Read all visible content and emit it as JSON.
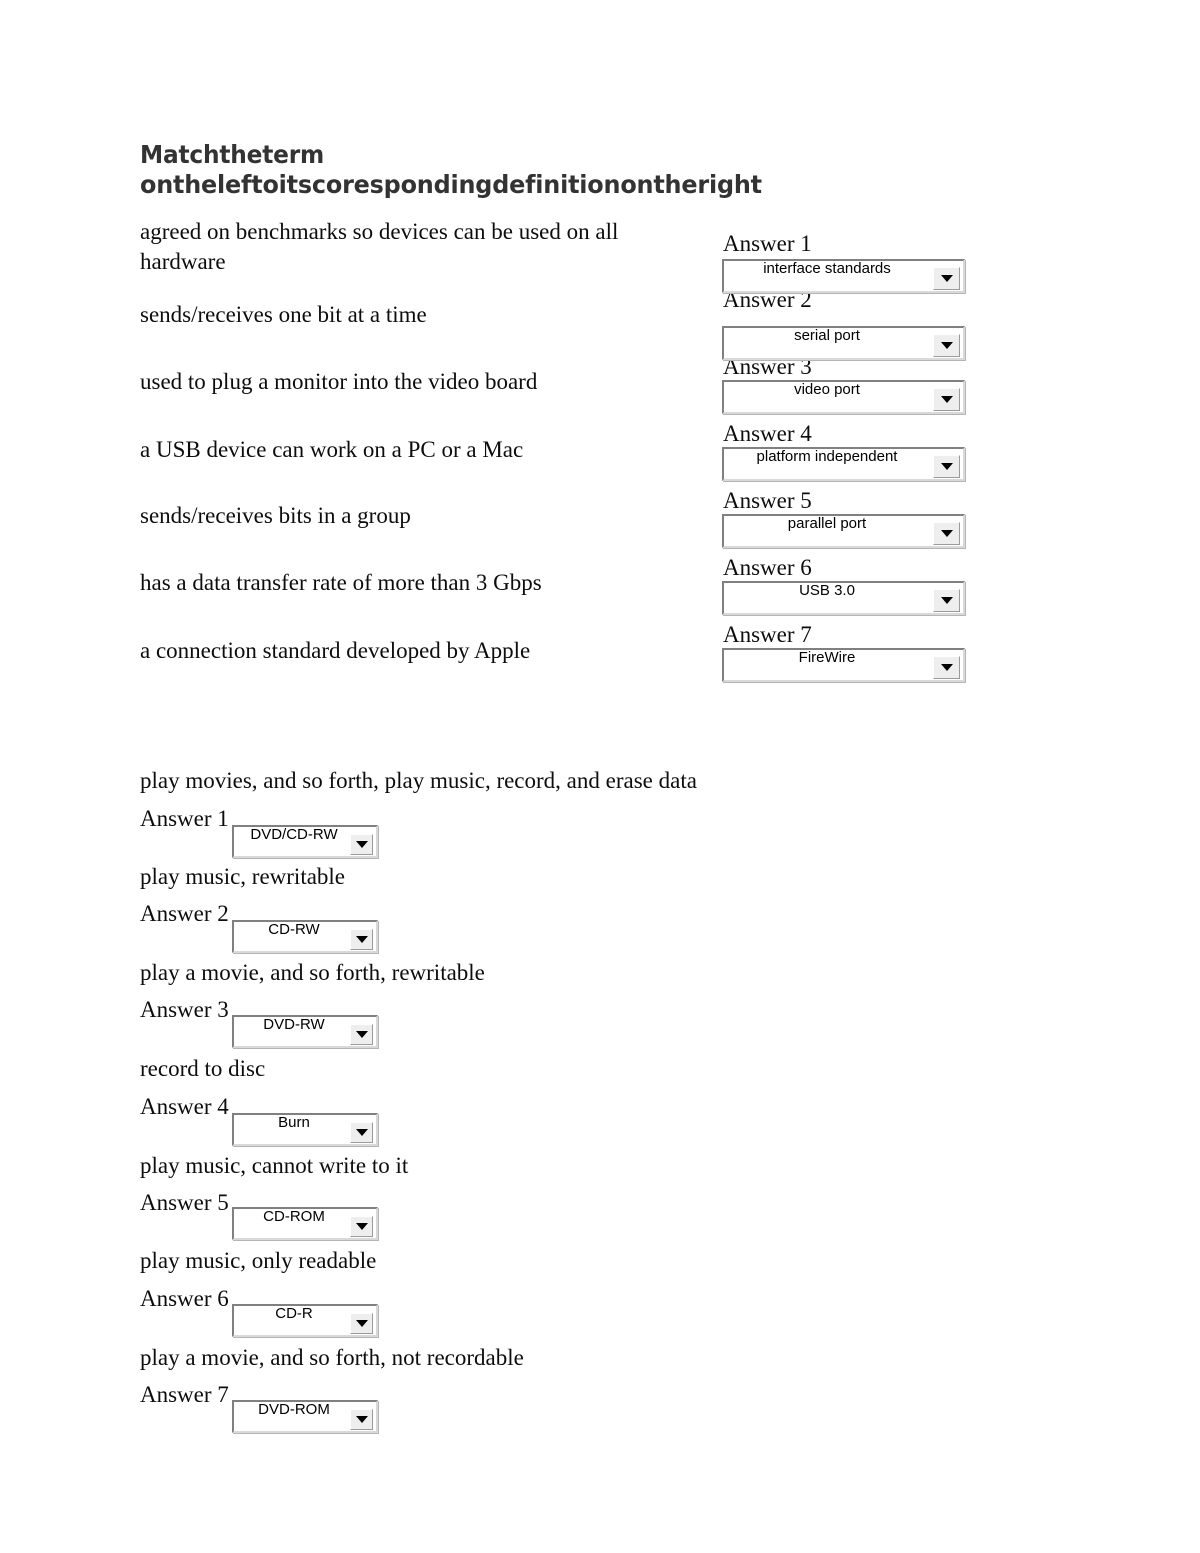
{
  "document": {
    "title_line_1": "Matchtheterm",
    "title_line_2": "ontheleftoitscorespondingdefinitionontheright"
  },
  "section_ports": {
    "terms": [
      "agreed on benchmarks so devices can be used on all hardware",
      "sends/receives one bit at a time",
      "used to plug a monitor into the video board",
      "a USB device can work on a PC or a Mac",
      "sends/receives bits in a group",
      "has a data transfer rate of more than 3 Gbps",
      "a connection standard developed by Apple"
    ],
    "answers": [
      {
        "label": "Answer 1",
        "value": "interface standards"
      },
      {
        "label": "Answer 2",
        "value": "serial port"
      },
      {
        "label": "Answer 3",
        "value": "video port"
      },
      {
        "label": "Answer 4",
        "value": "platform independent"
      },
      {
        "label": "Answer 5",
        "value": "parallel port"
      },
      {
        "label": "Answer 6",
        "value": "USB 3.0"
      },
      {
        "label": "Answer 7",
        "value": "FireWire"
      }
    ]
  },
  "section_discs": {
    "rows": [
      {
        "term": "play movies, and so forth, play music, record, and erase data",
        "label": "Answer 1",
        "value": "DVD/CD-RW"
      },
      {
        "term": "play music, rewritable",
        "label": "Answer 2",
        "value": "CD-RW"
      },
      {
        "term": "play a movie, and so forth, rewritable",
        "label": "Answer 3",
        "value": "DVD-RW"
      },
      {
        "term": "record to disc",
        "label": "Answer 4",
        "value": "Burn"
      },
      {
        "term": "play music, cannot write to it",
        "label": "Answer 5",
        "value": "CD-ROM"
      },
      {
        "term": "play music, only readable",
        "label": "Answer 6",
        "value": "CD-R"
      },
      {
        "term": "play a movie, and so forth, not recordable",
        "label": "Answer 7",
        "value": "DVD-ROM"
      }
    ]
  },
  "icons": {
    "dropdown_arrow": "chevron-down-icon"
  },
  "colors": {
    "page_background": "#ffffff",
    "body_text": "#0d0d0d",
    "title_text": "#333333",
    "combo_field": "#ffffff",
    "combo_border_dark": "#808080",
    "combo_border_light": "#d9d9d9",
    "combo_button_face": "#eeeeee"
  }
}
